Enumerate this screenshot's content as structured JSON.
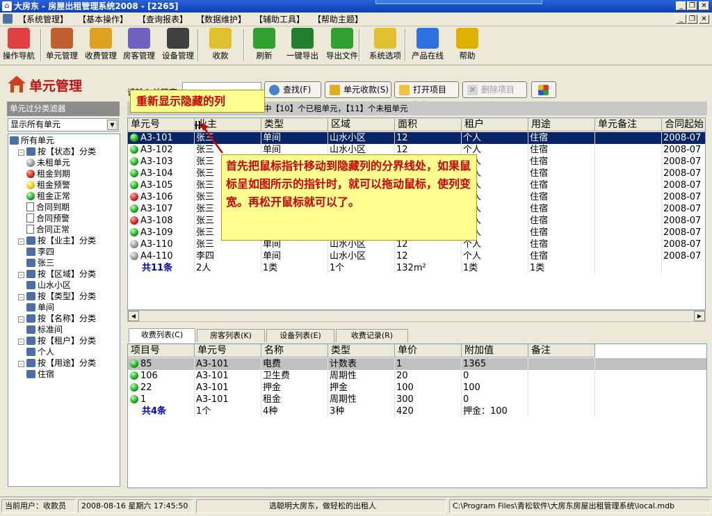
{
  "window": {
    "title": "大房东 - 房屋出租管理系统2008 - [2265]",
    "app_icon": "house-icon"
  },
  "menu": [
    "【系统管理】",
    "【基本操作】",
    "【查询报表】",
    "【数据维护】",
    "【辅助工具】",
    "【帮助主题】"
  ],
  "toolbar": [
    {
      "label": "操作导航",
      "icon": "navigation-icon"
    },
    {
      "label": "单元管理",
      "icon": "house-icon"
    },
    {
      "label": "收费管理",
      "icon": "coins-icon"
    },
    {
      "label": "房客管理",
      "icon": "people-icon"
    },
    {
      "label": "设备管理",
      "icon": "tv-icon"
    },
    {
      "label": "收款",
      "icon": "cash-icon"
    },
    {
      "label": "刷新",
      "icon": "refresh-icon"
    },
    {
      "label": "一键导出",
      "icon": "excel-icon"
    },
    {
      "label": "导出文件",
      "icon": "export-icon"
    },
    {
      "label": "系统选项",
      "icon": "options-icon"
    },
    {
      "label": "产品在线",
      "icon": "windows-icon"
    },
    {
      "label": "帮助",
      "icon": "help-icon"
    }
  ],
  "left": {
    "title": "单元管理",
    "filter_header": "单元过分类滤器",
    "filter_value": "显示所有单元",
    "tree": [
      {
        "label": "所有单元",
        "icon": "folder",
        "indent": 0
      },
      {
        "label": "按【状态】分类",
        "icon": "folder",
        "indent": 1,
        "pm": "-"
      },
      {
        "label": "未租单元",
        "icon": "gray",
        "indent": 2
      },
      {
        "label": "租金到期",
        "icon": "red",
        "indent": 2
      },
      {
        "label": "租金预警",
        "icon": "yellow",
        "indent": 2
      },
      {
        "label": "租金正常",
        "icon": "green",
        "indent": 2
      },
      {
        "label": "合同到期",
        "icon": "doc",
        "indent": 2
      },
      {
        "label": "合同预警",
        "icon": "doc",
        "indent": 2
      },
      {
        "label": "合同正常",
        "icon": "doc",
        "indent": 2
      },
      {
        "label": "按【业主】分类",
        "icon": "folder",
        "indent": 1,
        "pm": "-"
      },
      {
        "label": "李四",
        "icon": "folder",
        "indent": 2
      },
      {
        "label": "张三",
        "icon": "folder",
        "indent": 2
      },
      {
        "label": "按【区域】分类",
        "icon": "folder",
        "indent": 1,
        "pm": "-"
      },
      {
        "label": "山水小区",
        "icon": "folder",
        "indent": 2
      },
      {
        "label": "按【类型】分类",
        "icon": "folder",
        "indent": 1,
        "pm": "-"
      },
      {
        "label": "单间",
        "icon": "folder",
        "indent": 2
      },
      {
        "label": "按【名称】分类",
        "icon": "folder",
        "indent": 1,
        "pm": "-"
      },
      {
        "label": "标准间",
        "icon": "folder",
        "indent": 2
      },
      {
        "label": "按【租户】分类",
        "icon": "folder",
        "indent": 1,
        "pm": "-"
      },
      {
        "label": "个人",
        "icon": "folder",
        "indent": 2
      },
      {
        "label": "按【用途】分类",
        "icon": "folder",
        "indent": 1,
        "pm": "-"
      },
      {
        "label": "住宿",
        "icon": "folder",
        "indent": 2
      }
    ]
  },
  "actions": {
    "search_label": "请输入关键字",
    "search": "查找(F)",
    "collect": "单元收款(S)",
    "open": "打开项目(O)",
    "delete": "删除项目(D)"
  },
  "info_bar": "中【10】个已租单元，【11】个未租单元",
  "units": {
    "columns": [
      "单元号",
      "业主",
      "类型",
      "区域",
      "面积",
      "租户",
      "用途",
      "单元备注",
      "合同起始"
    ],
    "rows": [
      {
        "s": "green",
        "c": [
          "A3-101",
          "张三",
          "单间",
          "山水小区",
          "12",
          "个人",
          "住宿",
          "",
          "2008-07"
        ]
      },
      {
        "s": "green",
        "c": [
          "A3-102",
          "张三",
          "单间",
          "山水小区",
          "12",
          "个人",
          "住宿",
          "",
          "2008-07"
        ]
      },
      {
        "s": "green",
        "c": [
          "A3-103",
          "张三",
          "单间",
          "山水小区",
          "12",
          "个人",
          "住宿",
          "",
          "2008-07"
        ]
      },
      {
        "s": "green",
        "c": [
          "A3-104",
          "张三",
          "单间",
          "山水小区",
          "12",
          "个人",
          "住宿",
          "",
          "2008-07"
        ]
      },
      {
        "s": "green",
        "c": [
          "A3-105",
          "张三",
          "单间",
          "山水小区",
          "12",
          "个人",
          "住宿",
          "",
          "2008-07"
        ]
      },
      {
        "s": "red",
        "c": [
          "A3-106",
          "张三",
          "单间",
          "山水小区",
          "12",
          "个人",
          "住宿",
          "",
          "2008-07"
        ]
      },
      {
        "s": "green",
        "c": [
          "A3-107",
          "张三",
          "单间",
          "山水小区",
          "12",
          "个人",
          "住宿",
          "",
          "2008-07"
        ]
      },
      {
        "s": "red",
        "c": [
          "A3-108",
          "张三",
          "单间",
          "山水小区",
          "12",
          "个人",
          "住宿",
          "",
          "2008-07"
        ]
      },
      {
        "s": "green",
        "c": [
          "A3-109",
          "张三",
          "单间",
          "山水小区",
          "12",
          "个人",
          "住宿",
          "",
          "2008-07"
        ]
      },
      {
        "s": "gray",
        "c": [
          "A3-110",
          "张三",
          "单间",
          "山水小区",
          "12",
          "个人",
          "住宿",
          "",
          "2008-07"
        ]
      },
      {
        "s": "gray",
        "c": [
          "A4-110",
          "李四",
          "单间",
          "山水小区",
          "12",
          "个人",
          "住宿",
          "",
          "2008-07"
        ]
      }
    ],
    "total": [
      "共11条",
      "2人",
      "1类",
      "1个",
      "132m²",
      "1类",
      "1类",
      "",
      ""
    ]
  },
  "tabs": [
    "收费列表(C)",
    "房客列表(K)",
    "设备列表(E)",
    "收费记录(R)"
  ],
  "fees": {
    "columns": [
      "项目号",
      "单元号",
      "名称",
      "类型",
      "单价",
      "附加值",
      "备注"
    ],
    "rows": [
      {
        "s": "green",
        "c": [
          "85",
          "A3-101",
          "电费",
          "计数表",
          "1",
          "1365",
          ""
        ]
      },
      {
        "s": "green",
        "c": [
          "106",
          "A3-101",
          "卫生费",
          "周期性",
          "20",
          "0",
          ""
        ]
      },
      {
        "s": "green",
        "c": [
          "22",
          "A3-101",
          "押金",
          "押金",
          "100",
          "100",
          ""
        ]
      },
      {
        "s": "green",
        "c": [
          "1",
          "A3-101",
          "租金",
          "周期性",
          "300",
          "0",
          ""
        ]
      }
    ],
    "total": [
      "共4条",
      "1个",
      "4种",
      "3种",
      "420",
      "押金：100",
      ""
    ]
  },
  "tooltip1": "重新显示隐藏的列",
  "tooltip2": "首先把鼠标指针移动到隐藏列的分界线处，如果鼠标呈如图所示的指针时，就可以拖动鼠标，使列变宽。再松开鼠标就可以了。",
  "status": {
    "user": "当前用户：收款员",
    "datetime": "2008-08-16 星期六 17:45:50",
    "slogan": "选聪明大房东，做轻松的出租人",
    "path": "C:\\Program Files\\青松软件\\大房东房屋出租管理系统\\local.mdb"
  }
}
